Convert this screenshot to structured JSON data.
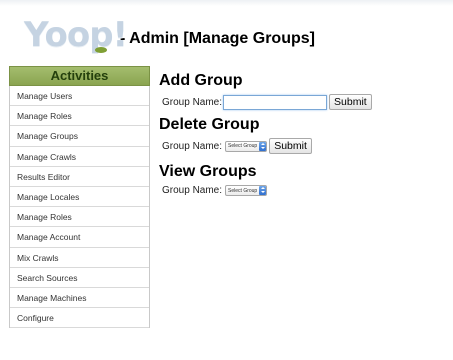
{
  "header": {
    "logo_text": "Yoop!",
    "title": "- Admin [Manage Groups]"
  },
  "sidebar": {
    "heading": "Activities",
    "items": [
      {
        "label": "Manage Users"
      },
      {
        "label": "Manage Roles"
      },
      {
        "label": "Manage Groups"
      },
      {
        "label": "Manage Crawls"
      },
      {
        "label": "Results Editor"
      },
      {
        "label": "Manage Locales"
      },
      {
        "label": "Manage Roles"
      },
      {
        "label": "Manage Account"
      },
      {
        "label": "Mix Crawls"
      },
      {
        "label": "Search Sources"
      },
      {
        "label": "Manage Machines"
      },
      {
        "label": "Configure"
      }
    ]
  },
  "add_group": {
    "title": "Add Group",
    "label": "Group Name:",
    "value": "",
    "submit": "Submit"
  },
  "delete_group": {
    "title": "Delete Group",
    "label": "Group Name:",
    "selected": "Select Group",
    "submit": "Submit"
  },
  "view_groups": {
    "title": "View Groups",
    "label": "Group Name:",
    "selected": "Select Group"
  },
  "colors": {
    "sidebar_header": "#9ab35f",
    "logo_text": "#c5d3e2",
    "logo_dot": "#8aa93f"
  }
}
